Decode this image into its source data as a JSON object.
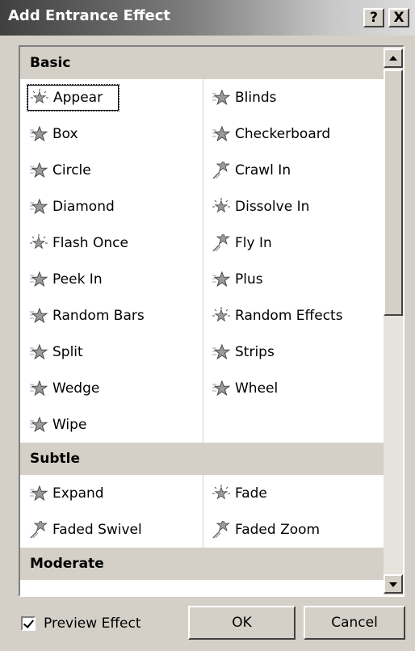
{
  "window": {
    "title": "Add Entrance Effect",
    "help_label": "?",
    "close_label": "X"
  },
  "categories": [
    {
      "name": "Basic",
      "items": [
        {
          "label": "Appear",
          "icon": "star-burst-icon",
          "selected": true
        },
        {
          "label": "Blinds",
          "icon": "star-icon"
        },
        {
          "label": "Box",
          "icon": "star-icon"
        },
        {
          "label": "Checkerboard",
          "icon": "star-icon"
        },
        {
          "label": "Circle",
          "icon": "star-icon"
        },
        {
          "label": "Crawl In",
          "icon": "flying-star-icon"
        },
        {
          "label": "Diamond",
          "icon": "star-icon"
        },
        {
          "label": "Dissolve In",
          "icon": "star-burst-icon"
        },
        {
          "label": "Flash Once",
          "icon": "star-burst-icon"
        },
        {
          "label": "Fly In",
          "icon": "flying-star-icon"
        },
        {
          "label": "Peek In",
          "icon": "star-icon"
        },
        {
          "label": "Plus",
          "icon": "star-icon"
        },
        {
          "label": "Random Bars",
          "icon": "star-icon"
        },
        {
          "label": "Random Effects",
          "icon": "star-burst-icon"
        },
        {
          "label": "Split",
          "icon": "star-icon"
        },
        {
          "label": "Strips",
          "icon": "star-icon"
        },
        {
          "label": "Wedge",
          "icon": "star-icon"
        },
        {
          "label": "Wheel",
          "icon": "star-icon"
        },
        {
          "label": "Wipe",
          "icon": "star-icon"
        }
      ]
    },
    {
      "name": "Subtle",
      "items": [
        {
          "label": "Expand",
          "icon": "star-icon"
        },
        {
          "label": "Fade",
          "icon": "star-burst-icon"
        },
        {
          "label": "Faded Swivel",
          "icon": "flying-star-icon"
        },
        {
          "label": "Faded Zoom",
          "icon": "flying-star-icon"
        }
      ]
    },
    {
      "name": "Moderate",
      "items": []
    }
  ],
  "footer": {
    "preview_label": "Preview Effect",
    "preview_checked": true,
    "ok_label": "OK",
    "cancel_label": "Cancel"
  }
}
